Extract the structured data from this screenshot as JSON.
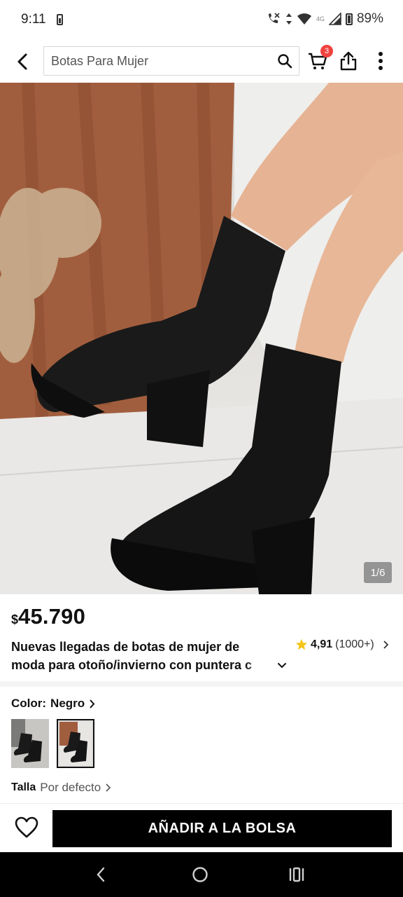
{
  "status_bar": {
    "time": "9:11",
    "battery_percent": "89%",
    "network_label": "4G"
  },
  "header": {
    "search_text": "Botas Para Mujer",
    "cart_count": "3"
  },
  "gallery": {
    "counter": "1/6"
  },
  "product": {
    "currency": "$",
    "price": "45.790",
    "title_line1": "Nuevas llegadas de botas de mujer de",
    "title_line2": "moda para otoño/invierno con puntera c",
    "rating": "4,91",
    "rating_count": "(1000+)"
  },
  "color": {
    "label": "Color:",
    "value": "Negro"
  },
  "size": {
    "label": "Talla",
    "value": "Por defecto"
  },
  "actions": {
    "add_to_bag": "AÑADIR A LA BOLSA"
  },
  "colors": {
    "accent_red": "#f1423f",
    "star_yellow": "#f5c518",
    "button_black": "#000000"
  }
}
